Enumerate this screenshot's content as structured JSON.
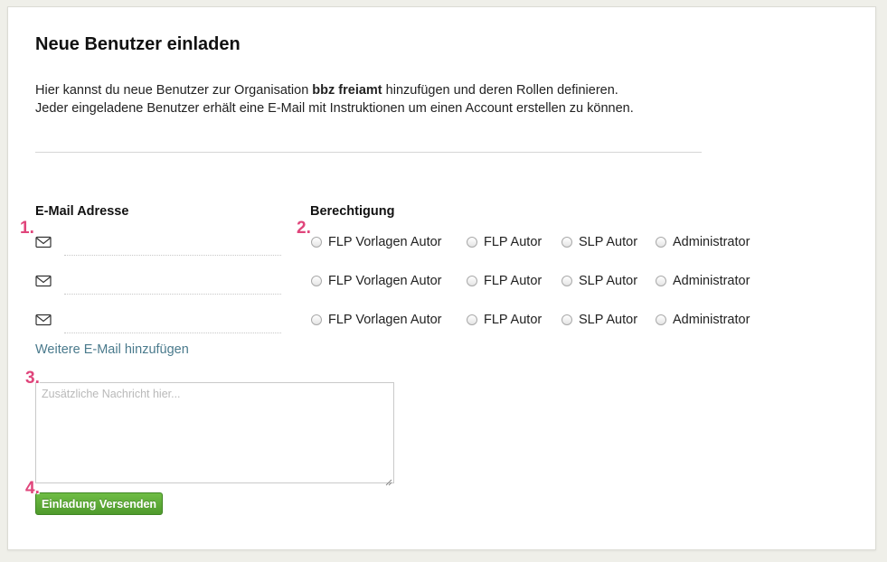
{
  "page": {
    "title": "Neue Benutzer einladen",
    "intro_line1_before": "Hier kannst du neue Benutzer zur Organisation ",
    "organisation": "bbz freiamt",
    "intro_line1_after": " hinzufügen und deren Rollen definieren.",
    "intro_line2": "Jeder eingeladene Benutzer erhält eine E-Mail mit Instruktionen um einen Account erstellen zu können."
  },
  "form": {
    "email_header": "E-Mail Adresse",
    "role_header": "Berechtigung",
    "email_rows": [
      {
        "value": ""
      },
      {
        "value": ""
      },
      {
        "value": ""
      }
    ],
    "roles": [
      "FLP Vorlagen Autor",
      "FLP Autor",
      "SLP Autor",
      "Administrator"
    ],
    "add_email_link": "Weitere E-Mail hinzufügen",
    "message_placeholder": "Zusätzliche Nachricht hier...",
    "send_button": "Einladung Versenden"
  },
  "annotations": [
    "1.",
    "2.",
    "3.",
    "4."
  ],
  "colors": {
    "accent_link": "#4a7a8c",
    "button_green": "#5aa835",
    "marker_pink": "#e0457b"
  }
}
